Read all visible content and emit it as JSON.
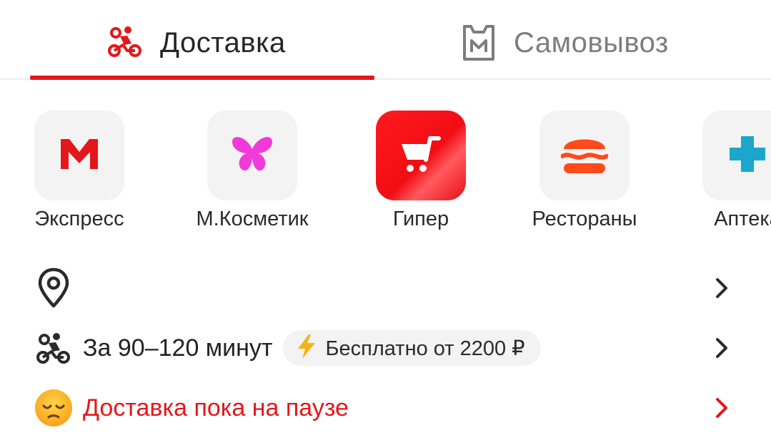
{
  "tabs": {
    "delivery_label": "Доставка",
    "pickup_label": "Самовывоз",
    "active": "delivery"
  },
  "categories": [
    {
      "label": "Экспресс",
      "icon": "magnit-m-icon"
    },
    {
      "label": "М.Косметик",
      "icon": "butterfly-icon"
    },
    {
      "label": "Гипер",
      "icon": "shopping-cart-icon",
      "active": true
    },
    {
      "label": "Рестораны",
      "icon": "burger-icon"
    },
    {
      "label": "Аптека",
      "icon": "pharmacy-cross-icon"
    }
  ],
  "address": {
    "icon": "location-pin-icon",
    "value": ""
  },
  "delivery_time": {
    "text": "За 90–120 минут",
    "badge_text": "Бесплатно от 2200 ₽",
    "badge_icon": "lightning-icon"
  },
  "pause": {
    "text": "Доставка пока на паузе",
    "icon": "sad-emoji-icon"
  },
  "colors": {
    "accent": "#e4171b",
    "tile_bg": "#f3f3f3",
    "butterfly": "#f23ad8",
    "burger": "#ff4a1c",
    "pharmacy": "#1aa7c9",
    "lightning": "#f5b416"
  }
}
